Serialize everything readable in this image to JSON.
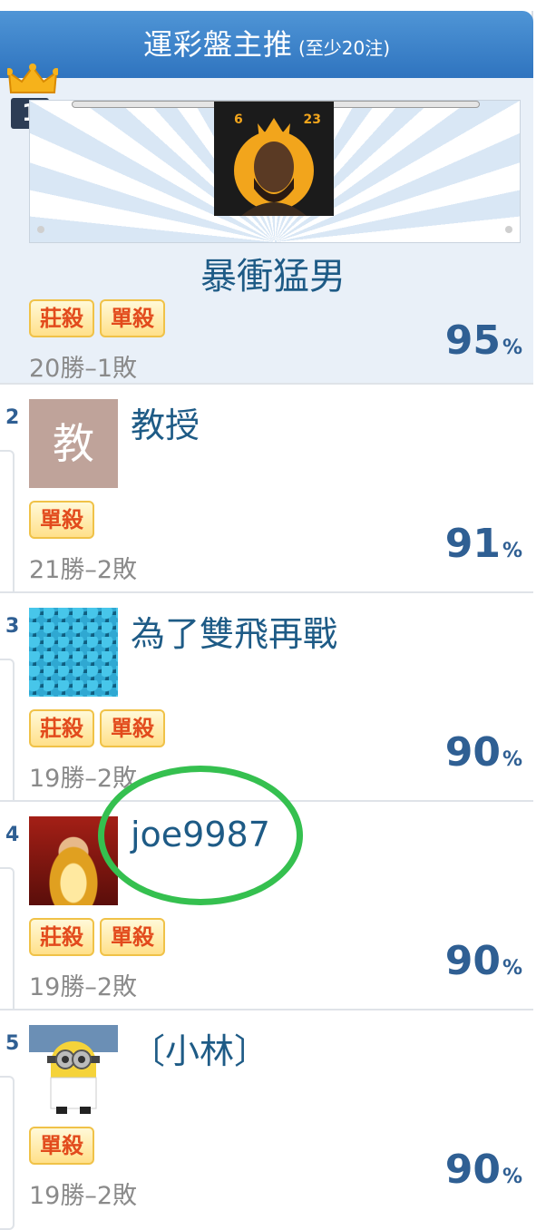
{
  "header": {
    "title": "運彩盤主推",
    "subtitle": "(至少20注)"
  },
  "top": {
    "rank": "1",
    "name": "暴衝猛男",
    "badges": [
      "莊殺",
      "單殺"
    ],
    "record": "20勝–1敗",
    "percent": "95",
    "percent_unit": "%",
    "jersey_left": "6",
    "jersey_right": "23"
  },
  "rows": [
    {
      "rank": "2",
      "name": "教授",
      "avatar_text": "教",
      "badges": [
        "單殺"
      ],
      "record": "21勝–2敗",
      "percent": "91",
      "percent_unit": "%"
    },
    {
      "rank": "3",
      "name": "為了雙飛再戰",
      "badges": [
        "莊殺",
        "單殺"
      ],
      "record": "19勝–2敗",
      "percent": "90",
      "percent_unit": "%"
    },
    {
      "rank": "4",
      "name": "joe9987",
      "badges": [
        "莊殺",
        "單殺"
      ],
      "record": "19勝–2敗",
      "percent": "90",
      "percent_unit": "%"
    },
    {
      "rank": "5",
      "name": "〔小林〕",
      "badges": [
        "單殺"
      ],
      "record": "19勝–2敗",
      "percent": "90",
      "percent_unit": "%"
    }
  ],
  "colors": {
    "header": "#3f86cd",
    "accent": "#2f5f93",
    "highlight": "#35c04f"
  }
}
